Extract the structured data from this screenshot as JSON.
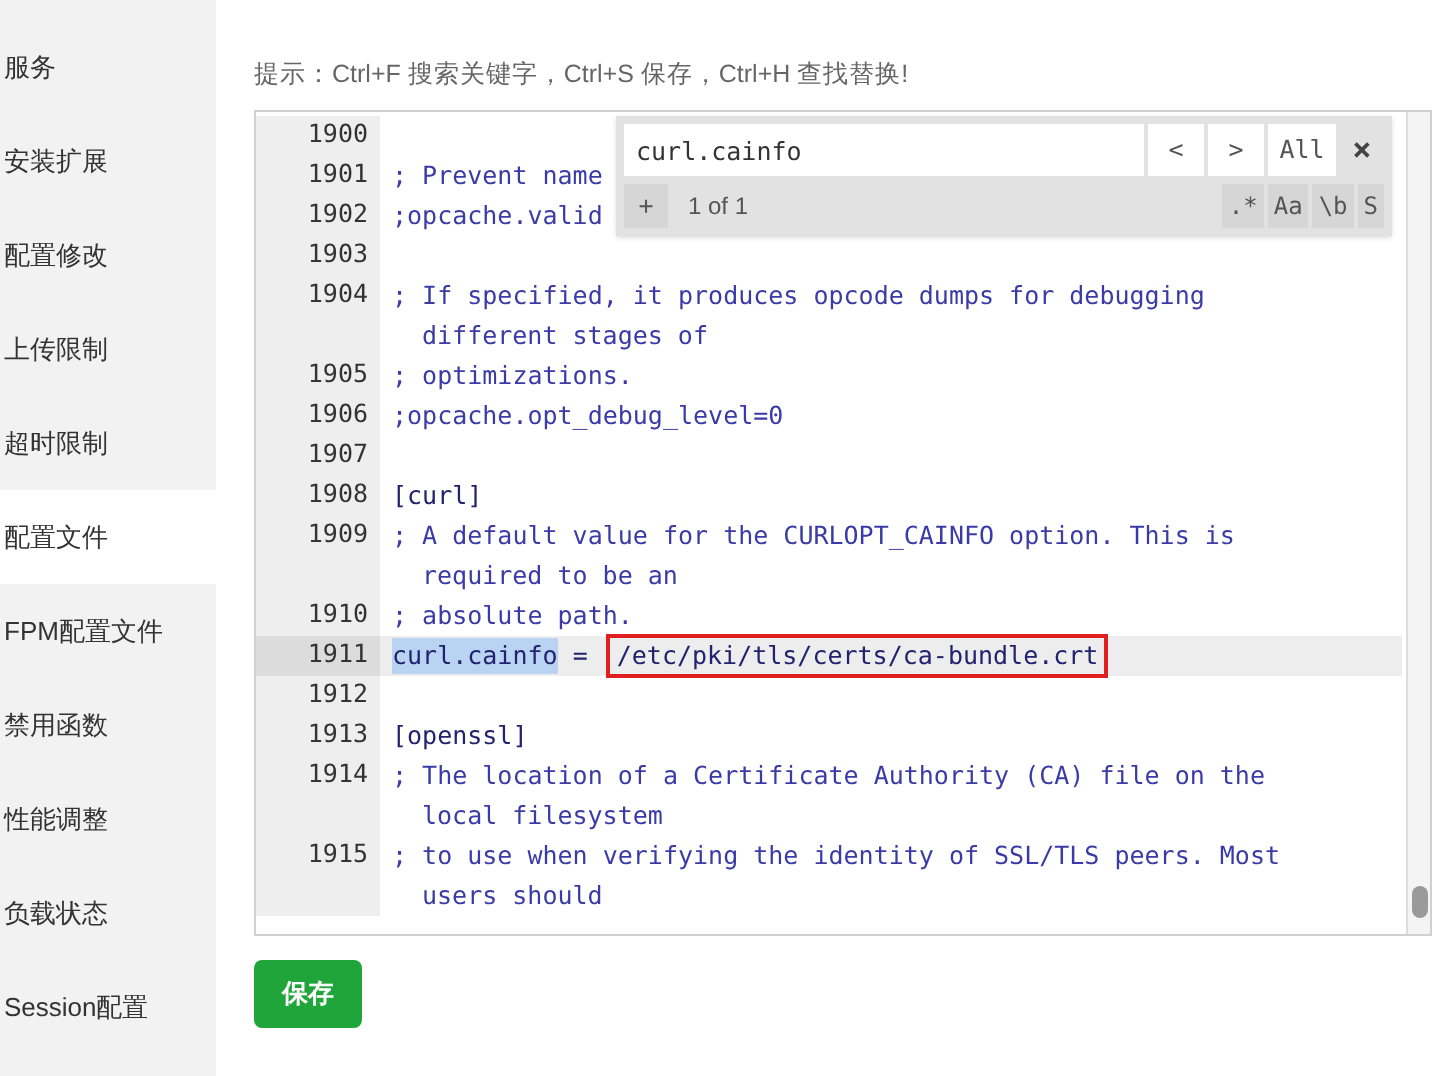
{
  "sidebar": {
    "items": [
      {
        "label": "服务",
        "selected": false
      },
      {
        "label": "安装扩展",
        "selected": false
      },
      {
        "label": "配置修改",
        "selected": false
      },
      {
        "label": "上传限制",
        "selected": false
      },
      {
        "label": "超时限制",
        "selected": false
      },
      {
        "label": "配置文件",
        "selected": true
      },
      {
        "label": "FPM配置文件",
        "selected": false
      },
      {
        "label": "禁用函数",
        "selected": false
      },
      {
        "label": "性能调整",
        "selected": false
      },
      {
        "label": "负载状态",
        "selected": false
      },
      {
        "label": "Session配置",
        "selected": false
      }
    ]
  },
  "hint": "提示：Ctrl+F 搜索关键字，Ctrl+S 保存，Ctrl+H 查找替换!",
  "editor": {
    "lines": [
      {
        "number": "1900",
        "active": false
      },
      {
        "number": "1901",
        "active": false,
        "segments": [
          {
            "kind": "comment",
            "text": "; Prevent name"
          }
        ]
      },
      {
        "number": "1902",
        "active": false,
        "segments": [
          {
            "kind": "comment",
            "text": ";opcache.valid"
          }
        ]
      },
      {
        "number": "1903",
        "active": false
      },
      {
        "number": "1904",
        "active": false,
        "segments": [
          {
            "kind": "comment",
            "text": "; If specified, it produces opcode dumps for debugging"
          },
          {
            "kind": "wrap",
            "text": "different stages of"
          }
        ]
      },
      {
        "number": "1905",
        "active": false,
        "segments": [
          {
            "kind": "comment",
            "text": "; optimizations."
          }
        ]
      },
      {
        "number": "1906",
        "active": false,
        "segments": [
          {
            "kind": "comment",
            "text": ";opcache.opt_debug_level=0"
          }
        ]
      },
      {
        "number": "1907",
        "active": false
      },
      {
        "number": "1908",
        "active": false,
        "segments": [
          {
            "kind": "code",
            "text": "[curl]"
          }
        ]
      },
      {
        "number": "1909",
        "active": false,
        "segments": [
          {
            "kind": "comment",
            "text": "; A default value for the CURLOPT_CAINFO option. This is"
          },
          {
            "kind": "wrap",
            "text": "required to be an"
          }
        ]
      },
      {
        "number": "1910",
        "active": false,
        "segments": [
          {
            "kind": "comment",
            "text": "; absolute path."
          }
        ]
      },
      {
        "number": "1911",
        "active": true,
        "segments": [
          {
            "kind": "match",
            "text": "curl.cainfo"
          },
          {
            "kind": "code",
            "text": " = "
          },
          {
            "kind": "boxed",
            "text": "/etc/pki/tls/certs/ca-bundle.crt"
          }
        ]
      },
      {
        "number": "1912",
        "active": false
      },
      {
        "number": "1913",
        "active": false,
        "segments": [
          {
            "kind": "code",
            "text": "[openssl]"
          }
        ]
      },
      {
        "number": "1914",
        "active": false,
        "segments": [
          {
            "kind": "comment",
            "text": "; The location of a Certificate Authority (CA) file on the"
          },
          {
            "kind": "wrap",
            "text": "local filesystem"
          }
        ]
      },
      {
        "number": "1915",
        "active": false,
        "segments": [
          {
            "kind": "comment",
            "text": "; to use when verifying the identity of SSL/TLS peers. Most"
          },
          {
            "kind": "wrap",
            "text": "users should"
          }
        ]
      }
    ],
    "search": {
      "value": "curl.cainfo",
      "prev": "<",
      "next": ">",
      "all": "All",
      "close": "×",
      "toggle": "+",
      "count": "1 of 1",
      "options": [
        ".*",
        "Aa",
        "\\b",
        "S"
      ]
    }
  },
  "save_button": "保存"
}
